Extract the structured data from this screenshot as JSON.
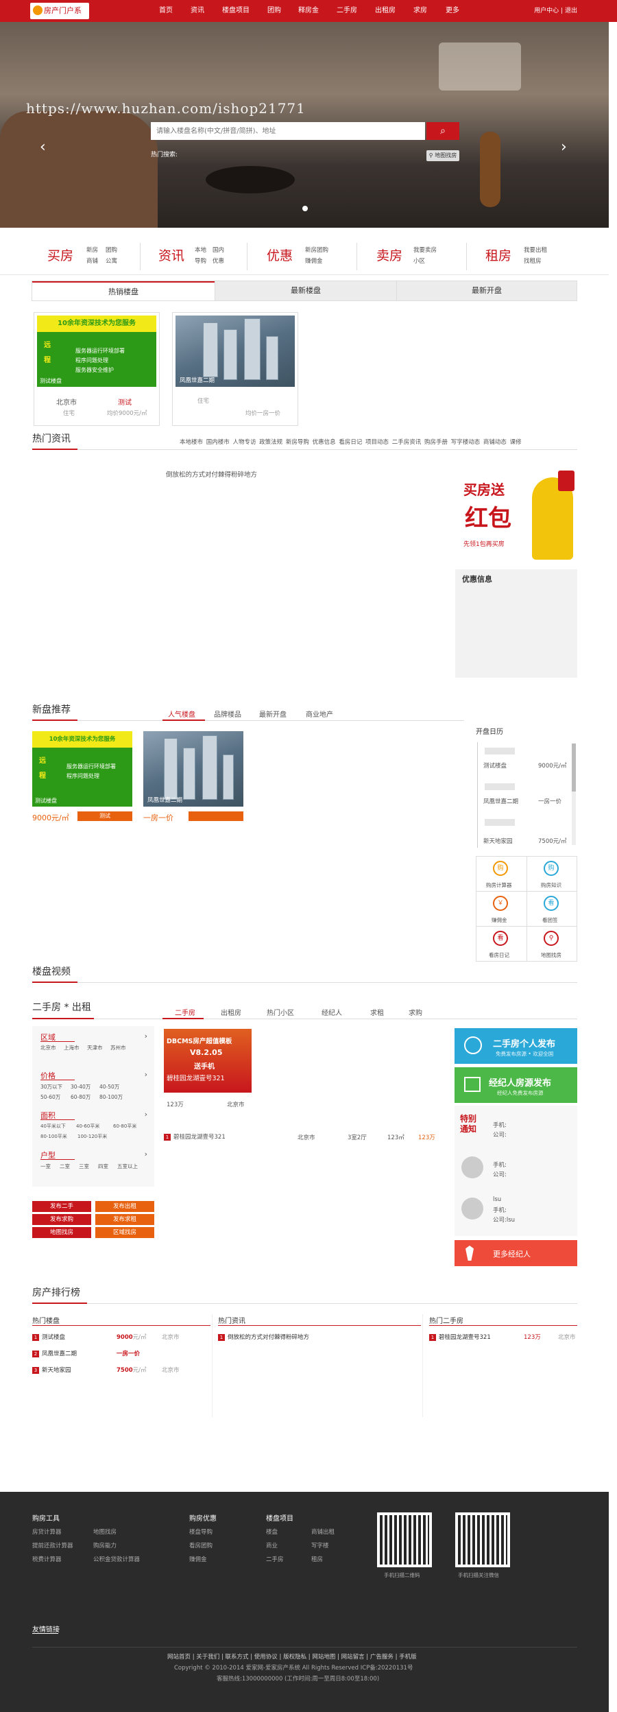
{
  "header": {
    "logo": "房产门户系",
    "nav": [
      "首页",
      "资讯",
      "楼盘项目",
      "团购",
      "释房金",
      "二手房",
      "出租房",
      "求房",
      "更多"
    ],
    "user_center": "用户中心",
    "logout": "退出",
    "sep": "|"
  },
  "banner": {
    "watermark": "https://www.huzhan.com/ishop21771",
    "search_placeholder": "请输入楼盘名称(中文/拼音/简拼)、地址",
    "hot_search_label": "热门搜索:",
    "map_search": "地图找房",
    "prev": "‹",
    "next": "›"
  },
  "quick": [
    {
      "title": "买房",
      "links": [
        "新房",
        "团购",
        "商铺",
        "公寓"
      ]
    },
    {
      "title": "资讯",
      "links": [
        "本地",
        "国内",
        "导购",
        "优惠"
      ]
    },
    {
      "title": "优惠",
      "links": [
        "新房团购",
        "赚佣金"
      ]
    },
    {
      "title": "卖房",
      "links": [
        "我要卖房",
        "小区"
      ]
    },
    {
      "title": "租房",
      "links": [
        "我要出租",
        "找租房"
      ]
    }
  ],
  "projects": {
    "tabs": [
      "热销楼盘",
      "最新楼盘",
      "最新开盘"
    ],
    "cards": [
      {
        "ad_top": "10余年资深技术为您服务",
        "ad_l1": "远",
        "ad_l2": "程",
        "ad_lines": [
          "服务器运行环境部署",
          "程序问题处理",
          "服务器安全维护"
        ],
        "caption": "测试楼盘",
        "city": "北京市",
        "type": "住宅",
        "name": "测试",
        "price": "均价9000元/㎡"
      },
      {
        "caption": "凤凰世嘉二期",
        "type": "住宅",
        "price": "均价一房一价"
      }
    ]
  },
  "news": {
    "title": "热门资讯",
    "tags": [
      "本地楼市",
      "国内楼市",
      "人物专访",
      "政策法规",
      "新房导购",
      "优惠信息",
      "看房日记",
      "项目动态",
      "二手房资讯",
      "购房手册",
      "写字楼动态",
      "商铺动态",
      "课修"
    ],
    "item": "倒放松的方式对付棘得粉碎地方",
    "promo_l1": "买房送",
    "promo_l2": "红包",
    "promo_l3": "先领1包再买房",
    "discount_title": "优惠信息"
  },
  "new_homes": {
    "title": "新盘推荐",
    "tabs": [
      "人气楼盘",
      "品牌楼品",
      "最新开盘",
      "商业地产"
    ],
    "cards": [
      {
        "caption": "测试楼盘",
        "price": "9000元/㎡",
        "btn": "测试"
      },
      {
        "caption": "凤凰世嘉二期",
        "price": "一房一价",
        "btn": ""
      }
    ],
    "calendar_title": "开盘日历",
    "calendar": [
      {
        "name": "测试楼盘",
        "price": "9000元/㎡"
      },
      {
        "name": "凤凰世嘉二期",
        "price": "一房一价"
      },
      {
        "name": "新天地家园",
        "price": "7500元/㎡"
      }
    ],
    "tools": [
      "购房计算器",
      "购房知识",
      "赚佣金",
      "看团签",
      "看房日记",
      "地图找房"
    ]
  },
  "video": {
    "title": "楼盘视频"
  },
  "second_hand": {
    "title": "二手房 * 出租",
    "tabs": [
      "二手房",
      "出租房",
      "热门小区",
      "经纪人",
      "求租",
      "求购"
    ],
    "filters": [
      {
        "name": "区域",
        "items": [
          "北京市",
          "上海市",
          "天津市",
          "苏州市"
        ]
      },
      {
        "name": "价格",
        "items": [
          "30万以下",
          "30-40万",
          "40-50万",
          "50-60万",
          "60-80万",
          "80-100万"
        ]
      },
      {
        "name": "面积",
        "items": [
          "40平米以下",
          "40-60平米",
          "60-80平米",
          "80-100平米",
          "100-120平米"
        ]
      },
      {
        "name": "户型",
        "items": [
          "一室",
          "二室",
          "三室",
          "四室",
          "五室以上"
        ]
      }
    ],
    "buttons": [
      "发布二手",
      "发布出租",
      "发布求购",
      "发布求租",
      "地图找房",
      "区域找房"
    ],
    "ad_l1": "DBCMS房产超值模板",
    "ad_l2": "V8.2.05",
    "ad_l3": "送手机",
    "ad_caption": "碧桂园龙湖壹号321",
    "listing": {
      "price": "123万",
      "city": "北京市",
      "name": "碧桂园龙湖壹号321",
      "layout": "3室2厅",
      "area": "123㎡",
      "total": "123万"
    },
    "publish_personal": "二手房个人发布",
    "publish_personal_sub": "免费发布房源 • 欢迎全国",
    "publish_agent": "经纪人房源发布",
    "publish_agent_sub": "经纪人免费发布房源",
    "notice_badge": "特别通知",
    "agents": [
      {
        "name": "",
        "phone": "手机:",
        "company": "公司:"
      },
      {
        "name": "",
        "phone": "手机:",
        "company": "公司:"
      },
      {
        "name": "lsu",
        "phone": "手机:",
        "company": "公司:lsu"
      }
    ],
    "more_agents": "更多经纪人"
  },
  "ranking": {
    "title": "房产排行榜",
    "hot_projects": {
      "title": "热门楼盘",
      "items": [
        {
          "name": "测试楼盘",
          "price": "9000",
          "unit": "元/㎡",
          "city": "北京市"
        },
        {
          "name": "凤凰世嘉二期",
          "price": "一房一价",
          "unit": "",
          "city": ""
        },
        {
          "name": "新天地家园",
          "price": "7500",
          "unit": "元/㎡",
          "city": "北京市"
        }
      ]
    },
    "hot_news": {
      "title": "热门资讯",
      "items": [
        "倒放松的方式对付棘得粉碎地方"
      ]
    },
    "hot_second": {
      "title": "热门二手房",
      "items": [
        {
          "name": "碧桂园龙湖壹号321",
          "price": "123万",
          "city": "北京市"
        }
      ]
    }
  },
  "footer": {
    "cols": [
      {
        "title": "购房工具",
        "links": [
          "房贷计算器",
          "地图找房",
          "提前还款计算器",
          "购房能力",
          "税费计算器",
          "公积金贷款计算器"
        ]
      },
      {
        "title": "购房优惠",
        "links": [
          "楼盘导购",
          "看房团购",
          "赚佣金"
        ]
      },
      {
        "title": "楼盘项目",
        "links": [
          "楼盘",
          "商铺出租",
          "商业",
          "写字楼",
          "二手房",
          "租房"
        ]
      }
    ],
    "qr1": "手机扫描二维码",
    "qr2": "手机扫描关注微信",
    "friend_links": "友情链接",
    "bottom_links": "网站首页 | 关于我们 | 联系方式 | 使用协议 | 版权隐私 | 网站地图 | 网站留言 | 广告服务 | 手机版",
    "copyright": "Copyright © 2010-2014 爱家网-爱家房产系统 All Rights Reserved    ICP备:20220131号",
    "hotline": "客服热线:13000000000 (工作时间:周一至周日8:00至18:00)"
  }
}
